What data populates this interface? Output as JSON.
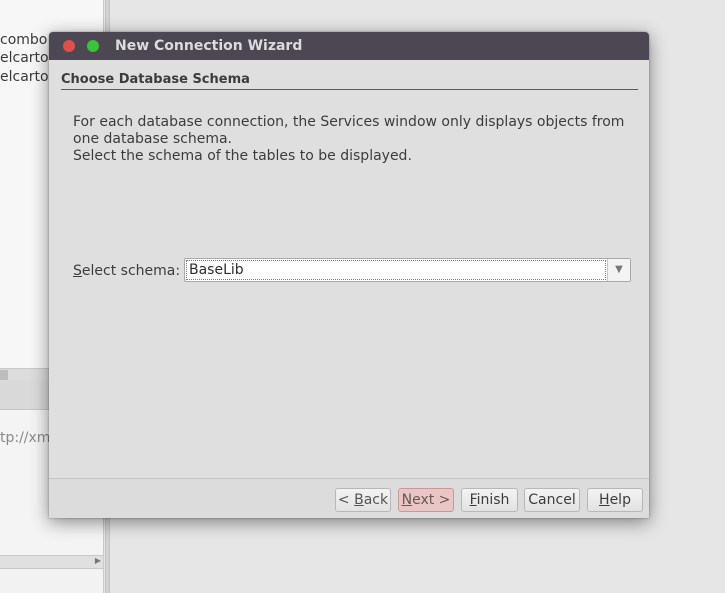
{
  "background": {
    "lines": [
      "combo",
      "elcarto",
      "elcarto"
    ],
    "url_fragment": "tp://xm"
  },
  "dialog": {
    "title": "New Connection Wizard",
    "step_title": "Choose Database Schema",
    "description_line1": "For each database connection, the Services window only displays objects from one database schema.",
    "description_line2": "Select the schema of the tables to be displayed.",
    "schema_label_mnemonic": "S",
    "schema_label_rest": "elect schema:",
    "schema_value": "BaseLib",
    "buttons": {
      "back_prefix": "< ",
      "back_mnemonic": "B",
      "back_rest": "ack",
      "next_mnemonic": "N",
      "next_rest": "ext >",
      "finish_mnemonic": "F",
      "finish_rest": "inish",
      "cancel": "Cancel",
      "help_mnemonic": "H",
      "help_rest": "elp"
    }
  },
  "colors": {
    "titlebar": "#4d4753",
    "close_button": "#e0504a",
    "maximize_button": "#3ec239",
    "next_button_tint": "#e9c5c5"
  },
  "icons": {
    "close": "close-circle-icon",
    "maximize": "maximize-circle-icon",
    "combo_arrow": "chevron-down-icon"
  }
}
